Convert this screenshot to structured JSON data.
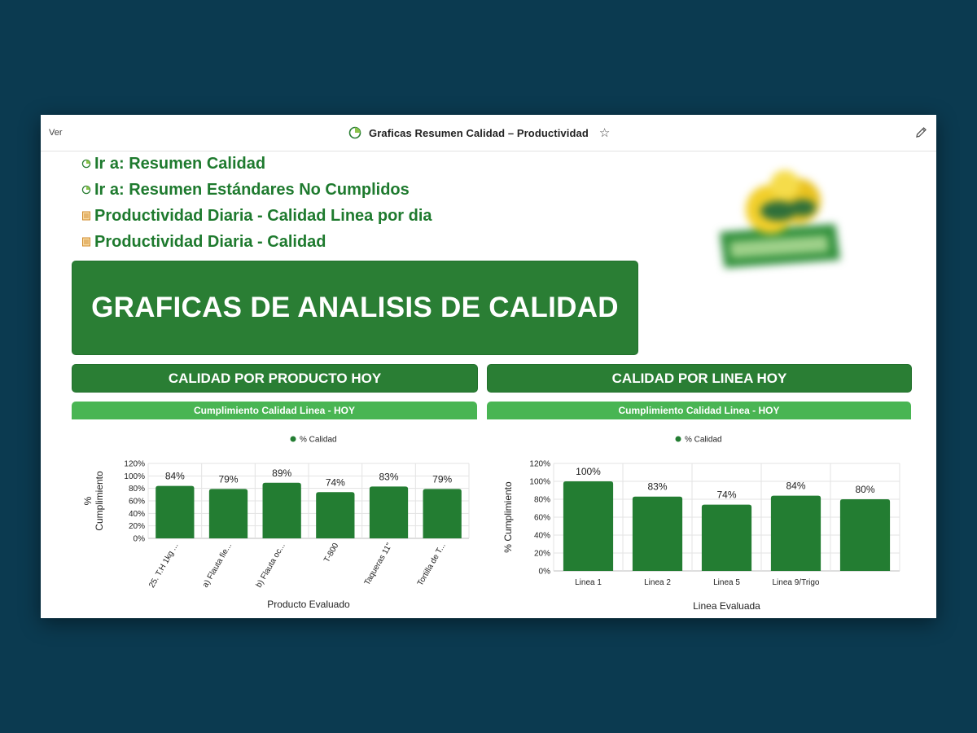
{
  "topbar": {
    "ver_label": "Ver",
    "title": "Graficas Resumen Calidad – Productividad"
  },
  "links": [
    {
      "icon": "chart-icon",
      "label": "Ir a: Resumen Calidad"
    },
    {
      "icon": "chart-icon",
      "label": "Ir a: Resumen Estándares No Cumplidos"
    },
    {
      "icon": "table-icon",
      "label": "Productividad Diaria - Calidad Linea por dia"
    },
    {
      "icon": "table-icon",
      "label": "Productividad Diaria - Calidad"
    }
  ],
  "banner": {
    "title": "GRAFICAS DE ANALISIS DE CALIDAD"
  },
  "sections": {
    "left_button": "CALIDAD POR PRODUCTO HOY",
    "right_button": "CALIDAD POR LINEA HOY",
    "left_header": "Cumplimiento Calidad Linea - HOY",
    "right_header": "Cumplimiento Calidad Linea - HOY"
  },
  "colors": {
    "brand_green": "#2a7e34",
    "header_green": "#49b553",
    "bar_green": "#237d32",
    "background": "#0b3a50"
  },
  "chart_data": [
    {
      "type": "bar",
      "legend": "% Calidad",
      "legend_position": "top",
      "categories": [
        "25. T.H 1kg ...",
        "a) Flauta fie...",
        "b) Flauta oc...",
        "T-800",
        "Taqueras 11\"",
        "Tortilla de T..."
      ],
      "series": [
        {
          "name": "% Calidad",
          "values": [
            84,
            79,
            89,
            74,
            83,
            79
          ]
        }
      ],
      "value_labels": [
        "84%",
        "79%",
        "89%",
        "74%",
        "83%",
        "79%"
      ],
      "y_ticks": [
        "0%",
        "20%",
        "40%",
        "60%",
        "80%",
        "100%",
        "120%"
      ],
      "ylim": [
        0,
        120
      ],
      "xlabel": "Producto Evaluado",
      "ylabel": "% Cumplimiento",
      "grid": true
    },
    {
      "type": "bar",
      "legend": "% Calidad",
      "legend_position": "top",
      "categories": [
        "Linea 1",
        "Linea 2",
        "Linea 5",
        "Linea 9/Trigo",
        ""
      ],
      "series": [
        {
          "name": "% Calidad",
          "values": [
            100,
            83,
            74,
            84,
            80
          ]
        }
      ],
      "value_labels": [
        "100%",
        "83%",
        "74%",
        "84%",
        "80%"
      ],
      "y_ticks": [
        "0%",
        "20%",
        "40%",
        "60%",
        "80%",
        "100%",
        "120%"
      ],
      "ylim": [
        0,
        120
      ],
      "xlabel": "Linea Evaluada",
      "ylabel": "% Cumplimiento",
      "grid": true
    }
  ]
}
